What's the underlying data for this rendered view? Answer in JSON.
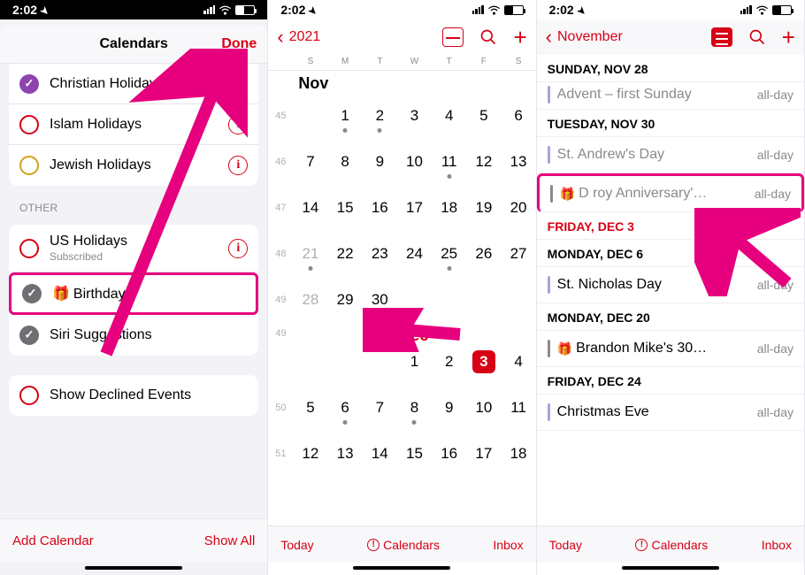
{
  "status": {
    "time": "2:02",
    "locArrow": "➤"
  },
  "screen1": {
    "title": "Calendars",
    "done": "Done",
    "holidays": [
      {
        "name": "Christian Holidays",
        "color": "#8e44ad",
        "checked": true,
        "info": true
      },
      {
        "name": "Islam Holidays",
        "color": "#d70015",
        "checked": false,
        "info": true
      },
      {
        "name": "Jewish Holidays",
        "color": "#d4a017",
        "checked": false,
        "info": true
      }
    ],
    "other_label": "OTHER",
    "other": [
      {
        "name": "US Holidays",
        "sub": "Subscribed",
        "color": "#d70015",
        "checked": false,
        "info": true
      },
      {
        "name": "Birthdays",
        "color": "#6e6e73",
        "checked": true,
        "gift": true,
        "highlight": true
      },
      {
        "name": "Siri Suggestions",
        "color": "#6e6e73",
        "checked": true
      }
    ],
    "declined": {
      "name": "Show Declined Events",
      "color": "#d70015",
      "checked": false
    },
    "footer": {
      "left": "Add Calendar",
      "right": "Show All"
    }
  },
  "screen2": {
    "back": "2021",
    "weekdays": [
      "S",
      "M",
      "T",
      "W",
      "T",
      "F",
      "S"
    ],
    "monthA": "Nov",
    "monthB": "Dec",
    "weeks": [
      {
        "wk": "45",
        "days": [
          {
            "n": ""
          },
          {
            "n": "1",
            "dot": true
          },
          {
            "n": "2",
            "dot": true
          },
          {
            "n": "3"
          },
          {
            "n": "4"
          },
          {
            "n": "5"
          },
          {
            "n": "6"
          }
        ]
      },
      {
        "wk": "46",
        "days": [
          {
            "n": "7"
          },
          {
            "n": "8"
          },
          {
            "n": "9"
          },
          {
            "n": "10"
          },
          {
            "n": "11",
            "dot": true
          },
          {
            "n": "12"
          },
          {
            "n": "13"
          }
        ]
      },
      {
        "wk": "47",
        "days": [
          {
            "n": "14"
          },
          {
            "n": "15"
          },
          {
            "n": "16"
          },
          {
            "n": "17"
          },
          {
            "n": "18"
          },
          {
            "n": "19"
          },
          {
            "n": "20"
          }
        ]
      },
      {
        "wk": "48",
        "days": [
          {
            "n": "21",
            "gray": true,
            "dot": true
          },
          {
            "n": "22"
          },
          {
            "n": "23"
          },
          {
            "n": "24"
          },
          {
            "n": "25",
            "dot": true
          },
          {
            "n": "26"
          },
          {
            "n": "27"
          }
        ]
      },
      {
        "wk": "49",
        "days": [
          {
            "n": "28",
            "gray": true
          },
          {
            "n": "29"
          },
          {
            "n": "30",
            "dot": true
          },
          {
            "n": ""
          },
          {
            "n": ""
          },
          {
            "n": ""
          },
          {
            "n": ""
          }
        ]
      }
    ],
    "decWeekNum": "49",
    "decWeeks": [
      {
        "wk": "",
        "days": [
          {
            "n": ""
          },
          {
            "n": ""
          },
          {
            "n": ""
          },
          {
            "n": "1"
          },
          {
            "n": "2"
          },
          {
            "n": "3",
            "today": true
          },
          {
            "n": "4"
          }
        ]
      },
      {
        "wk": "50",
        "days": [
          {
            "n": "5"
          },
          {
            "n": "6",
            "dot": true
          },
          {
            "n": "7"
          },
          {
            "n": "8",
            "dot": true
          },
          {
            "n": "9"
          },
          {
            "n": "10"
          },
          {
            "n": "11"
          }
        ]
      },
      {
        "wk": "51",
        "days": [
          {
            "n": "12"
          },
          {
            "n": "13"
          },
          {
            "n": "14"
          },
          {
            "n": "15"
          },
          {
            "n": "16"
          },
          {
            "n": "17"
          },
          {
            "n": "18"
          }
        ]
      }
    ],
    "footer": {
      "left": "Today",
      "center": "Calendars",
      "right": "Inbox"
    }
  },
  "screen3": {
    "back": "November",
    "sections": [
      {
        "header": "SUNDAY, NOV 28",
        "events": [
          {
            "title": "Advent – first Sunday",
            "time": "all-day",
            "color": "#b39ddb",
            "gray": true,
            "cut": true
          }
        ]
      },
      {
        "header": "TUESDAY, NOV 30",
        "events": [
          {
            "title": "St. Andrew's Day",
            "time": "all-day",
            "color": "#b39ddb",
            "gray": true
          },
          {
            "title": "D roy  Anniversary'…",
            "time": "all-day",
            "color": "#8a8a8e",
            "gift": true,
            "gray": true,
            "highlight": true
          }
        ]
      },
      {
        "header": "FRIDAY, DEC 3",
        "red": true,
        "events": []
      },
      {
        "header": "MONDAY, DEC 6",
        "events": [
          {
            "title": "St. Nicholas Day",
            "time": "all-day",
            "color": "#b39ddb"
          }
        ]
      },
      {
        "header": "MONDAY, DEC 20",
        "events": [
          {
            "title": "Brandon Mike's 30…",
            "time": "all-day",
            "color": "#8a8a8e",
            "gift": true
          }
        ]
      },
      {
        "header": "FRIDAY, DEC 24",
        "events": [
          {
            "title": "Christmas Eve",
            "time": "all-day",
            "color": "#b39ddb"
          }
        ]
      }
    ],
    "footer": {
      "left": "Today",
      "center": "Calendars",
      "right": "Inbox"
    }
  }
}
